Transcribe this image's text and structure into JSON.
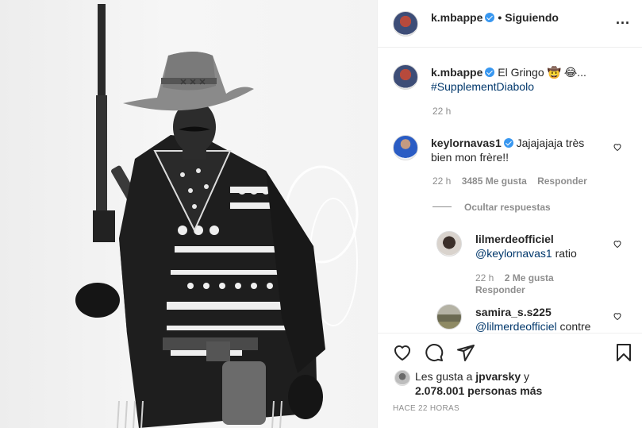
{
  "header": {
    "username": "k.mbappe",
    "separator": "•",
    "follow_status": "Siguiendo",
    "more_label": "..."
  },
  "caption": {
    "username": "k.mbappe",
    "text": "El Gringo",
    "emoji": "🤠 😂...",
    "hashtag": "#SupplementDiabolo",
    "time": "22 h"
  },
  "comments": [
    {
      "username": "keylornavas1",
      "line1": "Jajajajaja très",
      "line2": "bien mon frère!!",
      "time": "22 h",
      "likes": "3485 Me gusta",
      "reply": "Responder"
    }
  ],
  "toggle_replies": "Ocultar respuestas",
  "replies": [
    {
      "username": "lilmerdeofficiel",
      "mention": "@keylornavas1",
      "text": "ratio",
      "time": "22 h",
      "likes": "2 Me gusta",
      "reply": "Responder"
    },
    {
      "username": "samira_s.s225",
      "mention": "@lilmerdeofficiel",
      "text": "contre"
    }
  ],
  "likes_summary": {
    "prefix": "Les gusta a",
    "user": "jpvarsky",
    "suffix": "y",
    "count": "2.078.001 personas más"
  },
  "post_time": "HACE 22 HORAS",
  "icons": {
    "like": "heart-icon",
    "comment": "comment-icon",
    "share": "share-icon",
    "save": "bookmark-icon",
    "verified": "verified-badge-icon",
    "more": "more-options-icon"
  },
  "colors": {
    "verified": "#3897f0",
    "link": "#00376b",
    "muted": "#8e8e8e",
    "text": "#262626",
    "divider": "#efefef"
  }
}
